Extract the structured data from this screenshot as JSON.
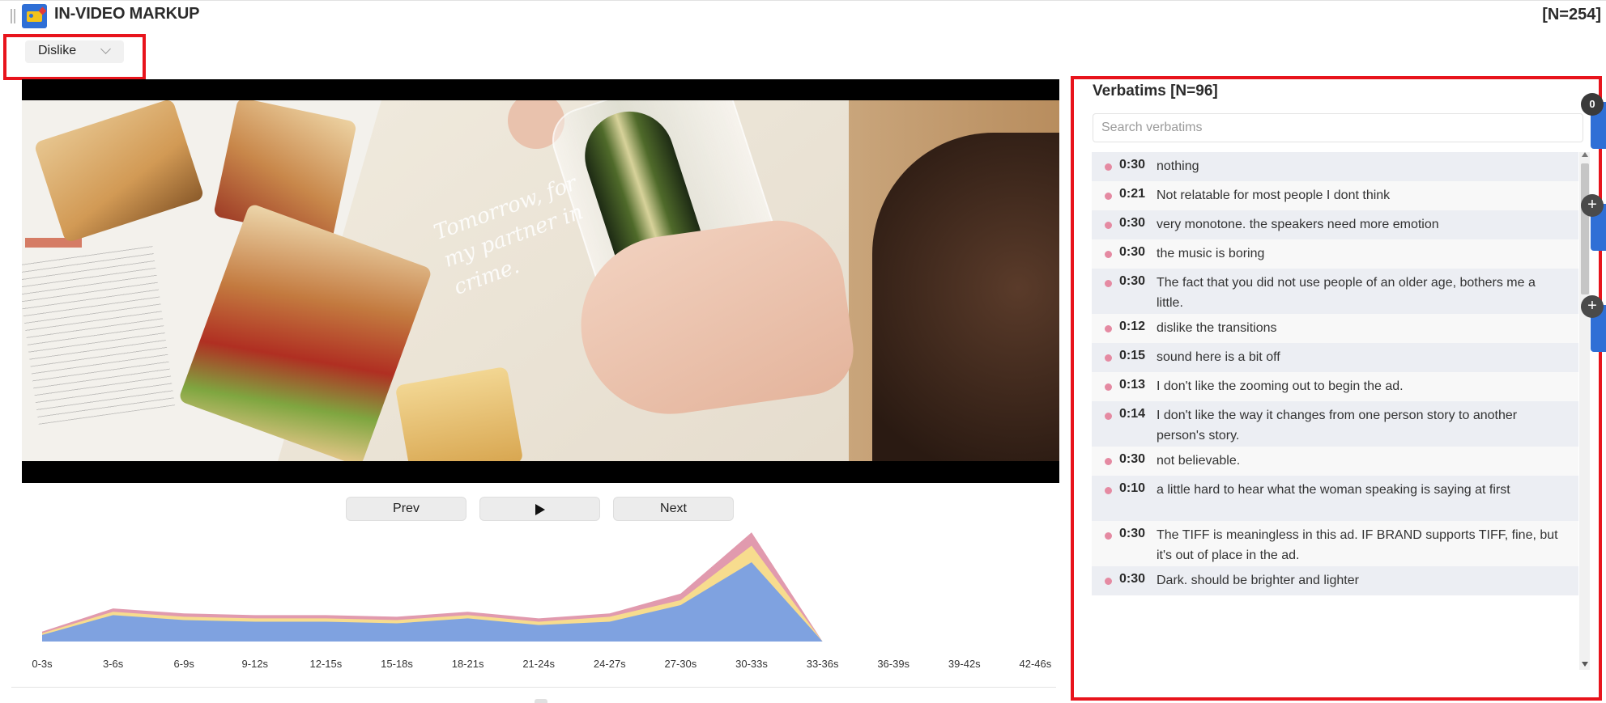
{
  "header": {
    "title": "IN-VIDEO MARKUP",
    "total_n": "[N=254]"
  },
  "filter": {
    "selected": "Dislike"
  },
  "video": {
    "overlay_text": "Tomorrow, for my partner in crime."
  },
  "controls": {
    "prev_label": "Prev",
    "next_label": "Next"
  },
  "verbatims": {
    "title": "Verbatims [N=96]",
    "search_placeholder": "Search verbatims",
    "items": [
      {
        "time": "0:30",
        "text": "nothing"
      },
      {
        "time": "0:21",
        "text": "Not relatable for most people I dont think"
      },
      {
        "time": "0:30",
        "text": "very monotone. the speakers need more emotion"
      },
      {
        "time": "0:30",
        "text": "the music is boring"
      },
      {
        "time": "0:30",
        "text": "The fact that you did not use people of an older age, bothers me a little."
      },
      {
        "time": "0:12",
        "text": "dislike the transitions"
      },
      {
        "time": "0:15",
        "text": "sound here is a bit off"
      },
      {
        "time": "0:13",
        "text": "I don't like the zooming out to begin the ad."
      },
      {
        "time": "0:14",
        "text": "I don't like the way it changes from one person story to another person's story."
      },
      {
        "time": "0:30",
        "text": "not believable."
      },
      {
        "time": "0:10",
        "text": "a little hard to hear what the woman speaking is saying at first"
      },
      {
        "time": "0:30",
        "text": "The TIFF is meaningless in this ad. IF BRAND supports TIFF, fine, but it's out of place in the ad."
      },
      {
        "time": "0:30",
        "text": "Dark. should be brighter and lighter"
      }
    ]
  },
  "side_panel": {
    "badge_count": "0",
    "plus_1": "+",
    "plus_2": "+"
  },
  "colors": {
    "accent_blue": "#2f6fd6",
    "highlight_red": "#e8141c",
    "series_blue": "#7fa2e0",
    "series_yellow": "#f7dc8e",
    "series_pink": "#e19aae"
  },
  "chart_data": {
    "type": "area",
    "stacked": true,
    "categories": [
      "0-3s",
      "3-6s",
      "6-9s",
      "9-12s",
      "12-15s",
      "15-18s",
      "18-21s",
      "21-24s",
      "24-27s",
      "27-30s",
      "30-33s",
      "33-36s",
      "36-39s",
      "39-42s",
      "42-46s"
    ],
    "series": [
      {
        "color": "#7fa2e0",
        "values": [
          4,
          16,
          13,
          12,
          12,
          11,
          14,
          10,
          12,
          22,
          48,
          0,
          0,
          0,
          0
        ]
      },
      {
        "color": "#f7dc8e",
        "values": [
          1,
          2,
          2,
          2,
          2,
          2,
          2,
          2,
          3,
          3,
          10,
          0,
          0,
          0,
          0
        ]
      },
      {
        "color": "#e19aae",
        "values": [
          1,
          2,
          2,
          2,
          2,
          2,
          2,
          2,
          2,
          4,
          8,
          0,
          0,
          0,
          0
        ]
      }
    ],
    "ylim": [
      0,
      70
    ],
    "grid": false,
    "legend": "none"
  }
}
